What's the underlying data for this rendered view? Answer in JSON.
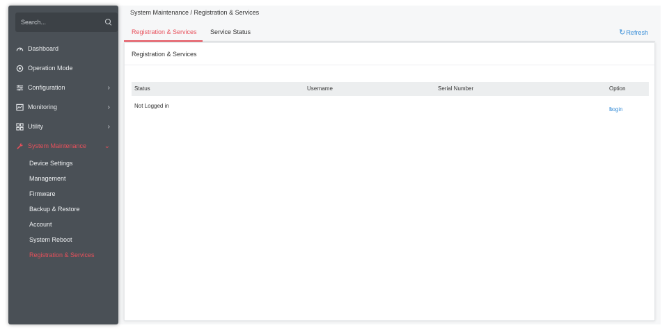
{
  "search": {
    "placeholder": "Search..."
  },
  "sidebar": {
    "items": [
      {
        "label": "Dashboard",
        "icon": "dashboard-icon"
      },
      {
        "label": "Operation Mode",
        "icon": "operation-mode-icon"
      },
      {
        "label": "Configuration",
        "icon": "configuration-icon"
      },
      {
        "label": "Monitoring",
        "icon": "monitoring-icon"
      },
      {
        "label": "Utility",
        "icon": "utility-icon"
      },
      {
        "label": "System Maintenance",
        "icon": "system-maintenance-icon"
      }
    ],
    "subitems": [
      {
        "label": "Device Settings"
      },
      {
        "label": "Management"
      },
      {
        "label": "Firmware"
      },
      {
        "label": "Backup & Restore"
      },
      {
        "label": "Account"
      },
      {
        "label": "System Reboot"
      },
      {
        "label": "Registration & Services"
      }
    ]
  },
  "header": {
    "breadcrumb": "System Maintenance / Registration & Services",
    "tabs": [
      {
        "label": "Registration & Services"
      },
      {
        "label": "Service Status"
      }
    ],
    "refresh_label": "Refresh"
  },
  "panel": {
    "title": "Registration & Services",
    "columns": [
      "Status",
      "Username",
      "Serial Number",
      "Option"
    ],
    "rows": [
      {
        "status": "Not Logged in",
        "username": "",
        "serial": "",
        "option": "Login"
      }
    ]
  },
  "colors": {
    "accent": "#e8505b",
    "link": "#3a8fd8",
    "sidebar_bg": "#4a5056"
  }
}
